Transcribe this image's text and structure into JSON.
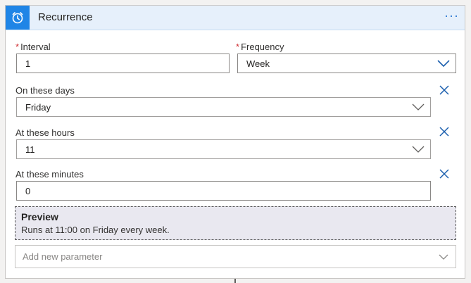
{
  "header": {
    "title": "Recurrence",
    "menu_glyph": "···",
    "icon": "alarm-clock-icon",
    "accent": "#1f85e6"
  },
  "fields": {
    "interval": {
      "label": "Interval",
      "required_mark": "*",
      "value": "1"
    },
    "frequency": {
      "label": "Frequency",
      "required_mark": "*",
      "value": "Week"
    },
    "days": {
      "label": "On these days",
      "value": "Friday"
    },
    "hours": {
      "label": "At these hours",
      "value": "11"
    },
    "minutes": {
      "label": "At these minutes",
      "value": "0"
    }
  },
  "preview": {
    "title": "Preview",
    "text": "Runs at 11:00 on Friday every week."
  },
  "add_parameter": {
    "placeholder": "Add new parameter"
  }
}
